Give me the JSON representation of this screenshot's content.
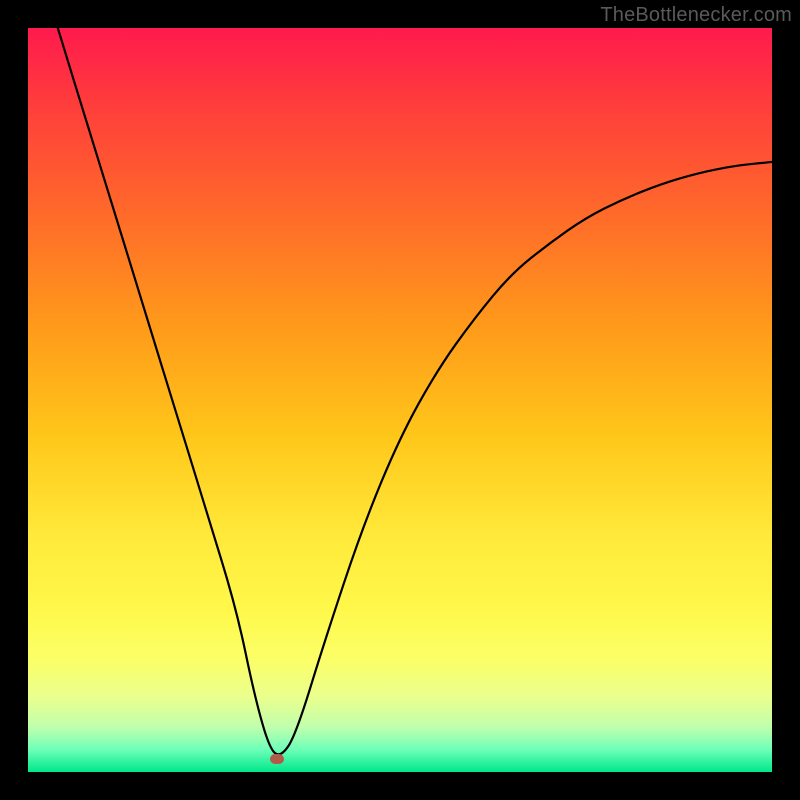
{
  "watermark": "TheBottlenecker.com",
  "marker": {
    "x_frac": 0.335,
    "y_frac": 0.983
  },
  "colors": {
    "background": "#000000",
    "curve": "#000000",
    "marker": "#b15a4a",
    "watermark": "#5a5a5a"
  },
  "chart_data": {
    "type": "line",
    "title": "",
    "xlabel": "",
    "ylabel": "",
    "xlim": [
      0,
      1
    ],
    "ylim": [
      0,
      1
    ],
    "legend": false,
    "grid": false,
    "background_gradient": [
      "#ff1a4d",
      "#ffe93a",
      "#00e78a"
    ],
    "series": [
      {
        "name": "bottleneck-curve",
        "x": [
          0.04,
          0.08,
          0.12,
          0.16,
          0.2,
          0.24,
          0.28,
          0.305,
          0.325,
          0.34,
          0.36,
          0.4,
          0.45,
          0.5,
          0.55,
          0.6,
          0.65,
          0.7,
          0.75,
          0.8,
          0.85,
          0.9,
          0.95,
          1.0
        ],
        "y": [
          1.0,
          0.87,
          0.74,
          0.61,
          0.48,
          0.35,
          0.22,
          0.1,
          0.03,
          0.02,
          0.05,
          0.18,
          0.33,
          0.45,
          0.54,
          0.61,
          0.67,
          0.71,
          0.745,
          0.77,
          0.79,
          0.805,
          0.815,
          0.82
        ]
      }
    ],
    "marker_point": {
      "x": 0.335,
      "y": 0.017
    },
    "annotations": [
      {
        "text": "TheBottlenecker.com",
        "pos": "top-right"
      }
    ]
  }
}
